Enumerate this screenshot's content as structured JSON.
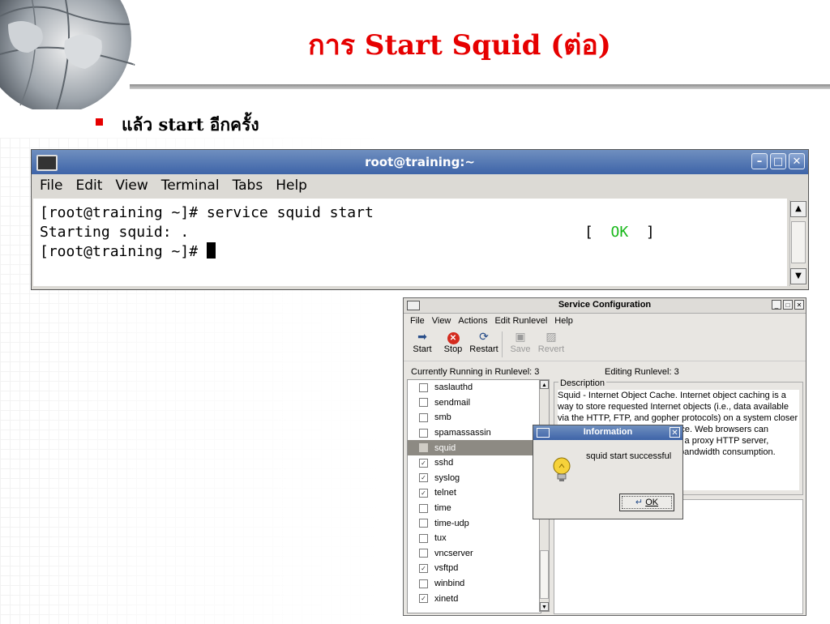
{
  "slide": {
    "title": "การ Start Squid (ต่อ)",
    "bullet": "แล้ว start อีกครั้ง"
  },
  "terminal": {
    "title": "root@training:~",
    "menu": [
      "File",
      "Edit",
      "View",
      "Terminal",
      "Tabs",
      "Help"
    ],
    "lines": {
      "line1": "[root@training ~]# service squid start",
      "line2": "Starting squid: .",
      "ok_open": "[  ",
      "ok": "OK",
      "ok_close": "  ]",
      "line3": "[root@training ~]# "
    }
  },
  "service_config": {
    "title": "Service Configuration",
    "menu": [
      "File",
      "View",
      "Actions",
      "Edit Runlevel",
      "Help"
    ],
    "toolbar": [
      {
        "label": "Start",
        "icon": "start-arrow-icon",
        "enabled": true
      },
      {
        "label": "Stop",
        "icon": "stop-icon",
        "enabled": true
      },
      {
        "label": "Restart",
        "icon": "restart-icon",
        "enabled": true
      },
      {
        "label": "Save",
        "icon": "save-icon",
        "enabled": false
      },
      {
        "label": "Revert",
        "icon": "revert-icon",
        "enabled": false
      }
    ],
    "currently_running": "Currently Running in Runlevel: 3",
    "editing_runlevel": "Editing Runlevel: 3",
    "services": [
      {
        "name": "saslauthd",
        "checked": false
      },
      {
        "name": "sendmail",
        "checked": false
      },
      {
        "name": "smb",
        "checked": false
      },
      {
        "name": "spamassassin",
        "checked": false
      },
      {
        "name": "squid",
        "checked": false,
        "selected": true
      },
      {
        "name": "sshd",
        "checked": true
      },
      {
        "name": "syslog",
        "checked": true
      },
      {
        "name": "telnet",
        "checked": true
      },
      {
        "name": "time",
        "checked": false
      },
      {
        "name": "time-udp",
        "checked": false
      },
      {
        "name": "tux",
        "checked": false
      },
      {
        "name": "vncserver",
        "checked": false
      },
      {
        "name": "vsftpd",
        "checked": true
      },
      {
        "name": "winbind",
        "checked": false
      },
      {
        "name": "xinetd",
        "checked": true
      }
    ],
    "description_label": "Description",
    "description_lines": [
      "Squid - Internet Object Cache. Internet object caching is a",
      "way to store requested Internet objects (i.e., data available",
      "via the HTTP, FTP, and gopher protocols) on a system closer",
      "source. Web browsers can",
      "s a proxy HTTP server,",
      "bandwidth consumption."
    ]
  },
  "dialog": {
    "title": "Information",
    "message": "squid start successful",
    "ok_label": "OK"
  },
  "colors": {
    "title_red": "#e60000",
    "titlebar_blue": "#3e64a8",
    "ok_green": "#18b81a"
  }
}
